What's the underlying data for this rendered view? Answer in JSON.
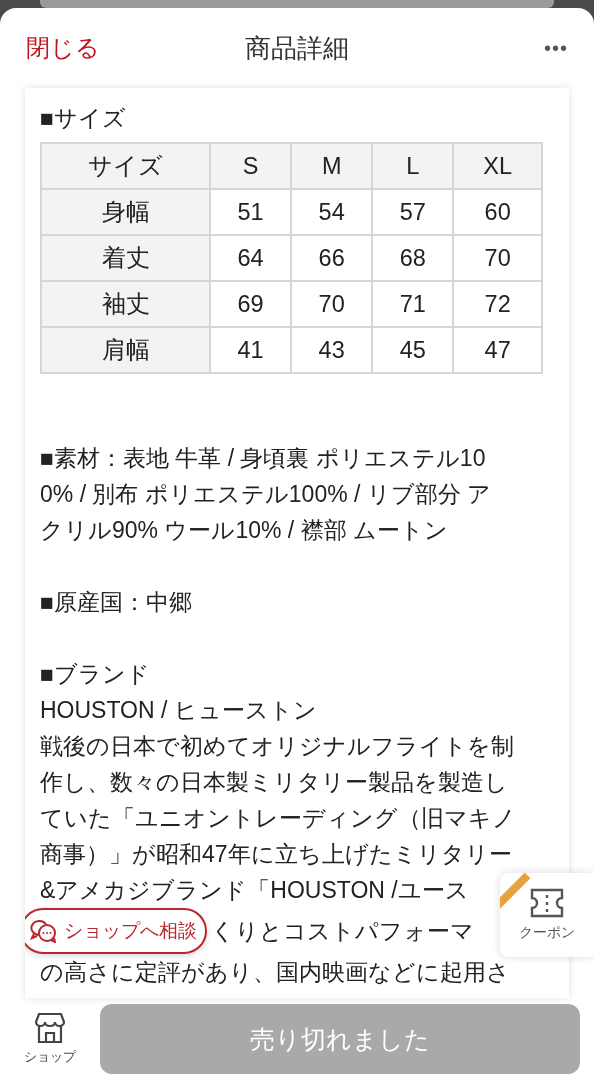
{
  "header": {
    "close": "閉じる",
    "title": "商品詳細",
    "more": "•••"
  },
  "size_section": {
    "heading": "■サイズ",
    "table": {
      "columns": [
        "サイズ",
        "S",
        "M",
        "L",
        "XL"
      ],
      "rows": [
        [
          "身幅",
          "51",
          "54",
          "57",
          "60"
        ],
        [
          "着丈",
          "64",
          "66",
          "68",
          "70"
        ],
        [
          "袖丈",
          "69",
          "70",
          "71",
          "72"
        ],
        [
          "肩幅",
          "41",
          "43",
          "45",
          "47"
        ]
      ]
    }
  },
  "material": {
    "lines": [
      "■素材：表地 牛革 / 身頃裏 ポリエステル10",
      "0% / 別布 ポリエステル100% / リブ部分 ア",
      "クリル90% ウール10% / 襟部 ムートン"
    ]
  },
  "origin": "■原産国：中郷",
  "brand": {
    "heading": "■ブランド",
    "name": "HOUSTON / ヒューストン",
    "lines": [
      "戦後の日本で初めてオリジナルフライトを制",
      "作し、数々の日本製ミリタリー製品を製造し",
      "ていた「ユニオントレーディング（旧マキノ",
      "商事）」が昭和47年に立ち上げたミリタリー",
      "&アメカジブランド「HOUSTON /ユース",
      "くりとコストパフォーマ",
      "の高さに定評があり、国内映画などに起用さ"
    ]
  },
  "chat_button": "ショップへ相談",
  "coupon": "クーポン",
  "footer": {
    "shop": "ショップ",
    "action": {
      "label": "売り切れました",
      "disabled": true
    }
  }
}
